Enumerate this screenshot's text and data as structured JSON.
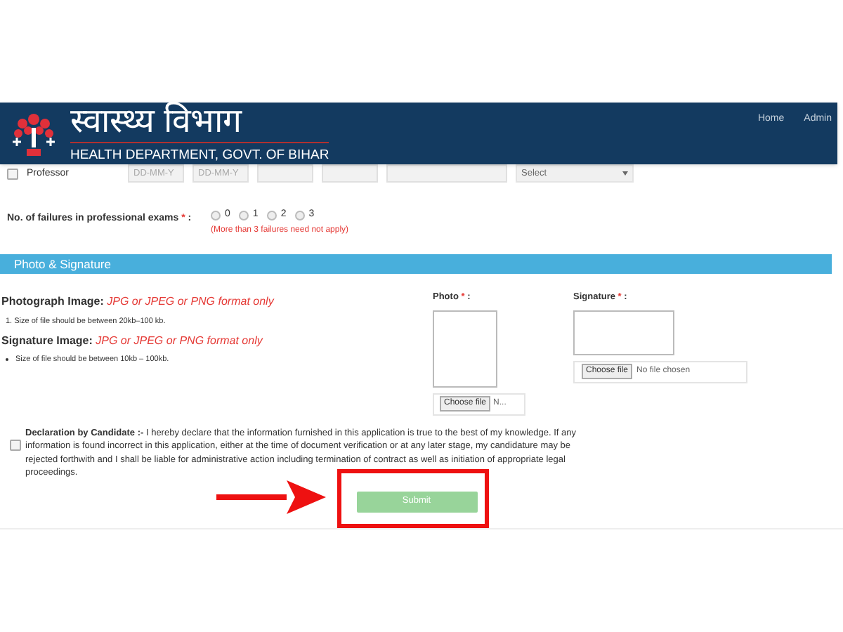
{
  "header": {
    "title_hindi": "स्वास्थ्य विभाग",
    "subtitle": "HEALTH DEPARTMENT, GOVT. OF BIHAR",
    "nav": [
      "Home",
      "Admin"
    ]
  },
  "professor_row": {
    "label": "Professor",
    "checked": false,
    "date_placeholders": [
      "DD-MM-Y",
      "DD-MM-Y"
    ],
    "select": "Select"
  },
  "failures": {
    "label": "No. of failures in professional exams",
    "required": "*",
    "suffix": ":",
    "options": [
      {
        "label": "0",
        "selected": false
      },
      {
        "label": "1",
        "selected": false
      },
      {
        "label": "2",
        "selected": false
      },
      {
        "label": "3",
        "selected": false
      }
    ],
    "note": "(More than 3 failures need not apply)"
  },
  "section": {
    "title": "Photo & Signature"
  },
  "photo_info": {
    "heading": "Photograph Image:",
    "format": "JPG or JPEG or PNG format only",
    "rule_marker": "1.",
    "rule": "Size of file should be between 20kb–100 kb."
  },
  "signature_info": {
    "heading": "Signature Image:",
    "format": "JPG or JPEG or PNG format only",
    "rule": "Size of file should be between 10kb – 100kb."
  },
  "photo_upload": {
    "label": "Photo",
    "required": "*",
    "suffix": ":",
    "button": "Choose file",
    "status": "N..."
  },
  "signature_upload": {
    "label": "Signature",
    "required": "*",
    "suffix": ":",
    "button": "Choose file",
    "status": "No file chosen"
  },
  "declaration": {
    "checked": false,
    "text": "**Declaration by Candidate :-**  I hereby declare that the information furnished in this application is true to the best of my knowledge. If any information is found incorrect in this application, either at the time of document verification or at any later stage, my candidature may be rejected forthwith and I shall be liable for administrative action including termination of contract as well as initiation of appropriate legal proceedings."
  },
  "submit": {
    "label": "Submit",
    "disabled": true
  }
}
